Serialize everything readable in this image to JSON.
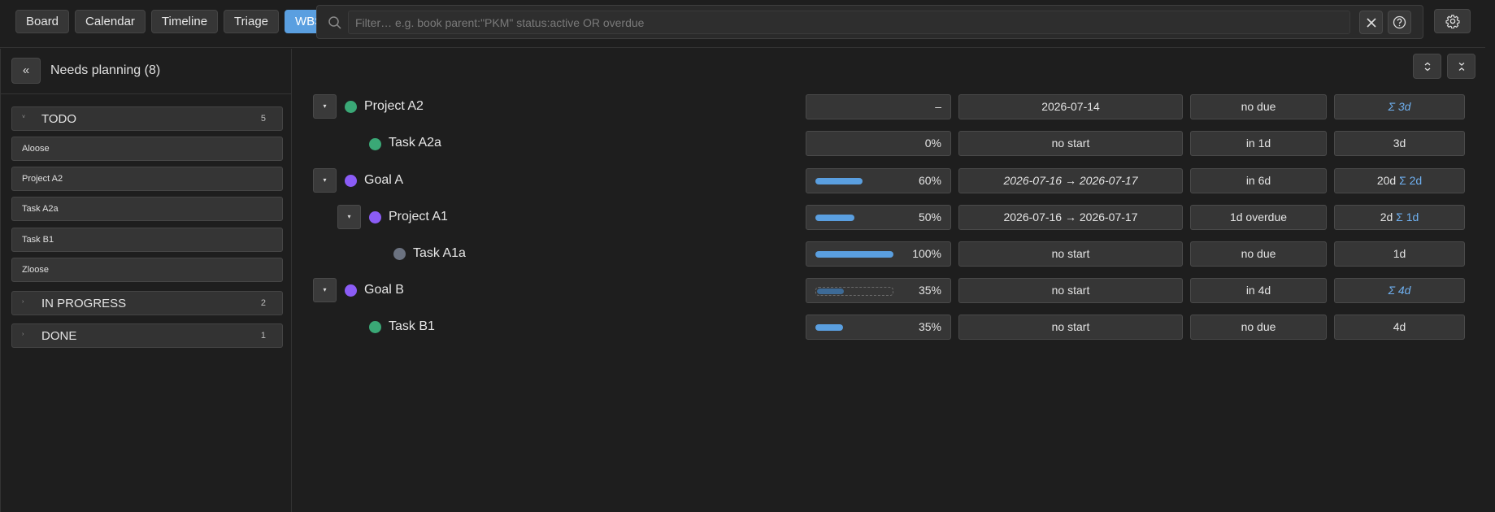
{
  "views": [
    "Board",
    "Calendar",
    "Timeline",
    "Triage",
    "WBS"
  ],
  "active_view": "WBS",
  "filter": {
    "placeholder": "Filter… e.g. book parent:\"PKM\" status:active OR overdue",
    "value": ""
  },
  "icons": {
    "search": "search-icon",
    "clear": "close-icon",
    "help": "help-circle-icon",
    "settings": "gear-icon",
    "expand": "expand-all-icon",
    "collapse": "collapse-all-icon"
  },
  "colors": {
    "accent": "#5a9fe0",
    "project": "#3aa876",
    "goal": "#8b5cf6",
    "done": "#6b7280"
  },
  "panel": {
    "collapse_label": "«",
    "title": "Needs planning (8)",
    "groups": [
      {
        "name": "TODO",
        "count": "5",
        "items": [
          "Aloose",
          "Project A2",
          "Task A2a",
          "Task B1",
          "Zloose"
        ]
      },
      {
        "name": "IN PROGRESS",
        "count": "2",
        "items": []
      },
      {
        "name": "DONE",
        "count": "1",
        "items": []
      }
    ]
  },
  "rows": [
    {
      "name": "Project A2",
      "toggle": "▾",
      "progress_text": "–",
      "dates": "2026-07-14",
      "due": "no due",
      "effort": "",
      "sigma": "Σ 3d"
    },
    {
      "name": "Task A2a",
      "toggle": "",
      "progress": 0,
      "progress_text": "0%",
      "dates": "no start",
      "due": "in 1d",
      "effort": "3d",
      "sigma": ""
    },
    {
      "name": "Goal A",
      "toggle": "▾",
      "progress": 60,
      "progress_text": "60%",
      "dates": "2026-07-16 → 2026-07-17",
      "due": "in 6d",
      "effort": "20d",
      "sigma": "Σ 2d"
    },
    {
      "name": "Project A1",
      "toggle": "▾",
      "progress": 50,
      "progress_text": "50%",
      "dates": "2026-07-16 → 2026-07-17",
      "due": "1d overdue",
      "effort": "2d",
      "sigma": "Σ 1d"
    },
    {
      "name": "Task A1a",
      "toggle": "",
      "progress": 100,
      "progress_text": "100%",
      "dates": "no start",
      "due": "no due",
      "effort": "1d",
      "sigma": ""
    },
    {
      "name": "Goal B",
      "toggle": "▾",
      "progress": 35,
      "progress_text": "35%",
      "dates": "no start",
      "due": "in 4d",
      "effort": "",
      "sigma": "Σ 4d"
    },
    {
      "name": "Task B1",
      "toggle": "",
      "progress": 35,
      "progress_text": "35%",
      "dates": "no start",
      "due": "no due",
      "effort": "4d",
      "sigma": ""
    }
  ]
}
